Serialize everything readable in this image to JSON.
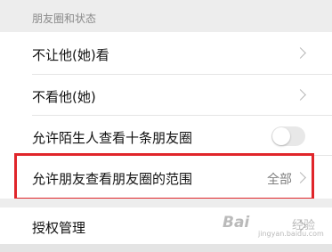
{
  "section": {
    "title": "朋友圈和状态"
  },
  "rows": {
    "dont_let_see": {
      "label": "不让他(她)看"
    },
    "dont_see": {
      "label": "不看他(她)"
    },
    "stranger_ten": {
      "label": "允许陌生人查看十条朋友圈",
      "toggle_on": false
    },
    "moments_range": {
      "label": "允许朋友查看朋友圈的范围",
      "value": "全部"
    },
    "authorization": {
      "label": "授权管理"
    }
  },
  "watermark": {
    "brand": "Bai",
    "suffix": "经验",
    "url": "jingyan.baidu.com"
  },
  "colors": {
    "highlight": "#e0252a",
    "background": "#ededed",
    "toggle_off": "#e8e8e8"
  }
}
